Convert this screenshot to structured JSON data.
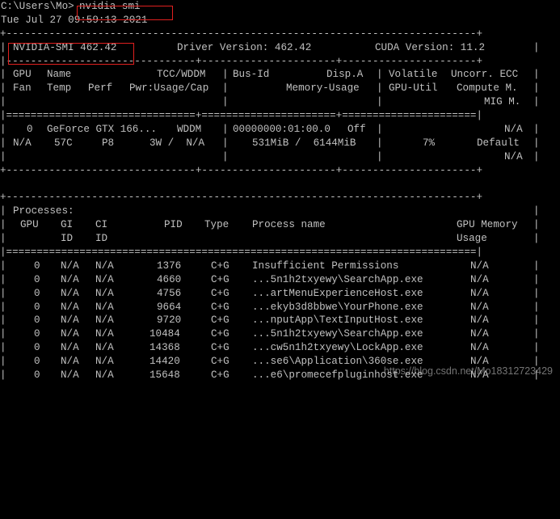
{
  "prompt": {
    "path": "C:\\Users\\Mo>",
    "command": "nvidia-smi"
  },
  "timestamp": "Tue Jul 27 09:59:13 2021",
  "border": {
    "top": "+-----------------------------------------------------------------------------+",
    "bottom": "+-----------------------------------------------------------------------------+",
    "header_sep": "|-------------------------------+----------------------+----------------------+",
    "header_eq": "|===============================+======================+======================|",
    "gpu_bottom": "+-------------------------------+----------------------+----------------------+",
    "bar": "|",
    "proc_eq": "|=============================================================================|"
  },
  "summary": {
    "smi_version": "NVIDIA-SMI 462.42",
    "driver_version": "Driver Version: 462.42",
    "cuda_version": "CUDA Version: 11.2"
  },
  "gpu_header": {
    "row1": [
      "GPU",
      "Name",
      "TCC/WDDM",
      "Bus-Id",
      "Disp.A",
      "Volatile",
      "Uncorr. ECC"
    ],
    "row2": [
      "Fan",
      "Temp",
      "Perf",
      "Pwr:Usage/Cap",
      "Memory-Usage",
      "GPU-Util",
      "Compute M."
    ],
    "row3": [
      "MIG M."
    ]
  },
  "gpu": {
    "index": "0",
    "name": "GeForce GTX 166...",
    "mode": "WDDM",
    "bus_id": "00000000:01:00.0",
    "disp_a": "Off",
    "ecc": "N/A",
    "fan": "N/A",
    "temp": "57C",
    "perf": "P8",
    "power": "3W /  N/A",
    "memory": "531MiB /  6144MiB",
    "util": "7%",
    "compute": "Default",
    "mig": "N/A"
  },
  "processes": {
    "title": "Processes:",
    "headers_row1": [
      "GPU",
      "GI",
      "CI",
      "PID",
      "Type",
      "Process name",
      "GPU Memory"
    ],
    "headers_row2": [
      "ID",
      "ID",
      "Usage"
    ],
    "rows": [
      {
        "gpu": "0",
        "gi": "N/A",
        "ci": "N/A",
        "pid": "1376",
        "type": "C+G",
        "name": "Insufficient Permissions",
        "mem": "N/A"
      },
      {
        "gpu": "0",
        "gi": "N/A",
        "ci": "N/A",
        "pid": "4660",
        "type": "C+G",
        "name": "...5n1h2txyewy\\SearchApp.exe",
        "mem": "N/A"
      },
      {
        "gpu": "0",
        "gi": "N/A",
        "ci": "N/A",
        "pid": "4756",
        "type": "C+G",
        "name": "...artMenuExperienceHost.exe",
        "mem": "N/A"
      },
      {
        "gpu": "0",
        "gi": "N/A",
        "ci": "N/A",
        "pid": "9664",
        "type": "C+G",
        "name": "...ekyb3d8bbwe\\YourPhone.exe",
        "mem": "N/A"
      },
      {
        "gpu": "0",
        "gi": "N/A",
        "ci": "N/A",
        "pid": "9720",
        "type": "C+G",
        "name": "...nputApp\\TextInputHost.exe",
        "mem": "N/A"
      },
      {
        "gpu": "0",
        "gi": "N/A",
        "ci": "N/A",
        "pid": "10484",
        "type": "C+G",
        "name": "...5n1h2txyewy\\SearchApp.exe",
        "mem": "N/A"
      },
      {
        "gpu": "0",
        "gi": "N/A",
        "ci": "N/A",
        "pid": "14368",
        "type": "C+G",
        "name": "...cw5n1h2txyewy\\LockApp.exe",
        "mem": "N/A"
      },
      {
        "gpu": "0",
        "gi": "N/A",
        "ci": "N/A",
        "pid": "14420",
        "type": "C+G",
        "name": "...se6\\Application\\360se.exe",
        "mem": "N/A"
      },
      {
        "gpu": "0",
        "gi": "N/A",
        "ci": "N/A",
        "pid": "15648",
        "type": "C+G",
        "name": "...e6\\promecefpluginhost.exe",
        "mem": "N/A"
      }
    ]
  },
  "watermark": "https://blog.csdn.net/Mo18312723429",
  "colors": {
    "background": "#000000",
    "text": "#c0c0c0",
    "highlight_box": "#e0201f"
  }
}
